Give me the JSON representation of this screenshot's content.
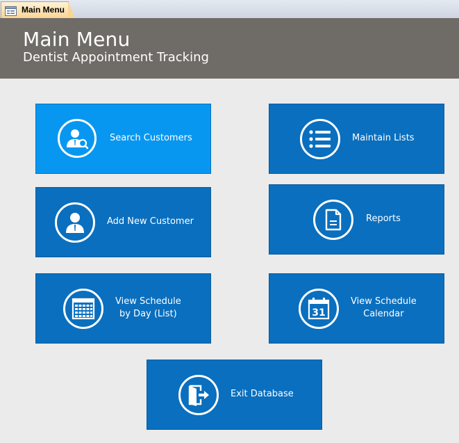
{
  "tab": {
    "label": "Main Menu",
    "icon": "form-icon"
  },
  "header": {
    "title": "Main Menu",
    "subtitle": "Dentist Appointment Tracking",
    "background": "#6f6b66"
  },
  "colors": {
    "button": "#0a6fbe",
    "button_active": "#0897f0",
    "background": "#ebebeb"
  },
  "buttons": {
    "search_customers": {
      "label": "Search Customers",
      "icon": "user-search-icon"
    },
    "maintain_lists": {
      "label": "Maintain Lists",
      "icon": "list-icon"
    },
    "add_new_customer": {
      "label": "Add New Customer",
      "icon": "user-icon"
    },
    "reports": {
      "label": "Reports",
      "icon": "document-icon"
    },
    "view_schedule_day": {
      "label_line1": "View Schedule",
      "label_line2": "by Day (List)",
      "icon": "calendar-grid-icon"
    },
    "view_schedule_calendar": {
      "label_line1": "View Schedule",
      "label_line2": "Calendar",
      "icon": "calendar-31-icon"
    },
    "exit_database": {
      "label": "Exit Database",
      "icon": "exit-door-icon"
    }
  }
}
